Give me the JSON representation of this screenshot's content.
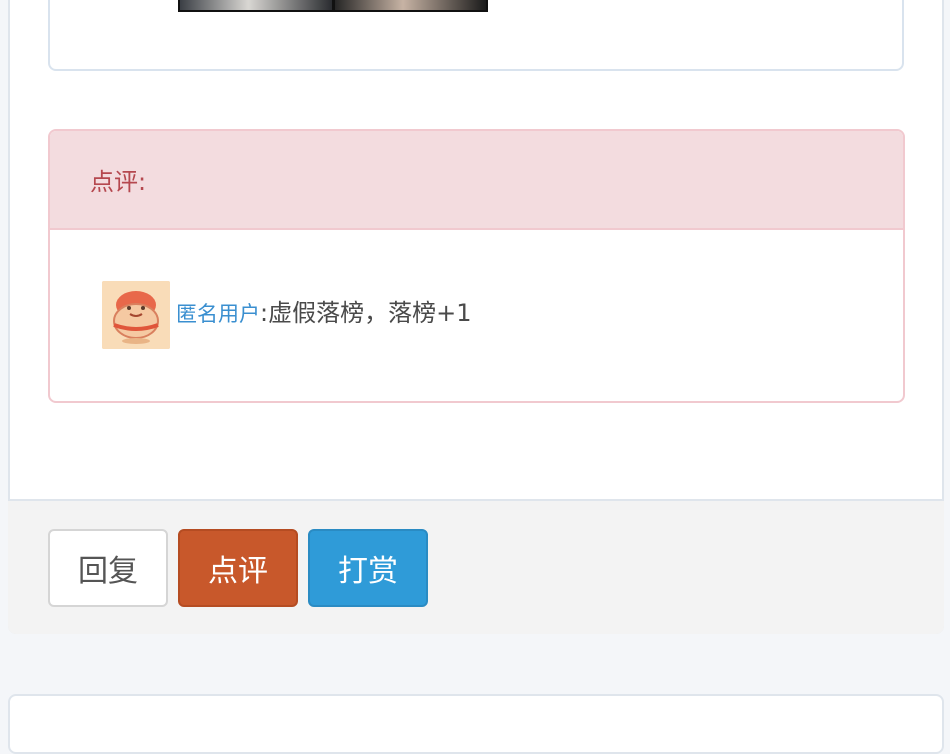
{
  "review": {
    "header_label": "点评:",
    "comment": {
      "username": "匿名用户",
      "separator": ":",
      "text": "虚假落榜，落榜+1"
    }
  },
  "actions": {
    "reply_label": "回复",
    "review_label": "点评",
    "reward_label": "打赏"
  },
  "colors": {
    "review_header_bg": "#f3dcdf",
    "review_header_text": "#b5484f",
    "username_link": "#3a8fd0",
    "review_button": "#c8582b",
    "reward_button": "#2f9bd8"
  }
}
